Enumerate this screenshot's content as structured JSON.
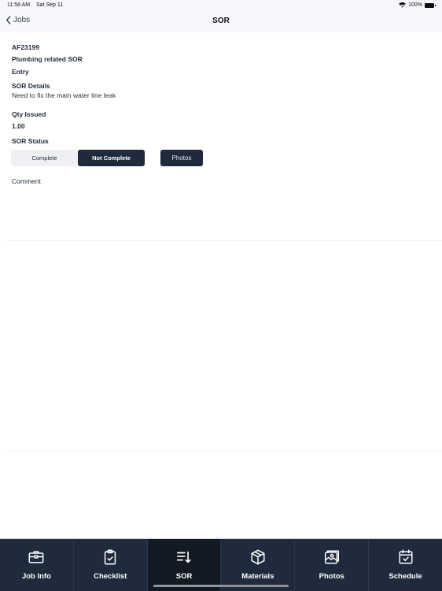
{
  "status_bar": {
    "time": "11:58 AM",
    "date": "Sat Sep 11",
    "battery": "100%"
  },
  "nav": {
    "back_label": "Jobs",
    "title": "SOR"
  },
  "sor": {
    "code": "AF23199",
    "name": "Plumbing related SOR",
    "type": "Entry",
    "details_label": "SOR Details",
    "details_value": "Need to fix the main water line leak",
    "qty_label": "Qty Issued",
    "qty_value": "1.00",
    "status_label": "SOR Status",
    "status_options": [
      "Complete",
      "Not Complete"
    ],
    "status_selected": "Not Complete",
    "photos_button": "Photos",
    "comment_label": "Comment",
    "comment_value": ""
  },
  "tabs": [
    {
      "label": "Job Info",
      "icon": "briefcase-icon",
      "active": false
    },
    {
      "label": "Checklist",
      "icon": "clipboard-check-icon",
      "active": false
    },
    {
      "label": "SOR",
      "icon": "sort-down-icon",
      "active": true
    },
    {
      "label": "Materials",
      "icon": "box-icon",
      "active": false
    },
    {
      "label": "Photos",
      "icon": "photos-icon",
      "active": false
    },
    {
      "label": "Schedule",
      "icon": "calendar-check-icon",
      "active": false
    }
  ],
  "colors": {
    "primary": "#1f2a3d",
    "active_tab": "#141a24",
    "header_bg": "#f7f8fb",
    "segment_bg": "#eff0f3"
  }
}
